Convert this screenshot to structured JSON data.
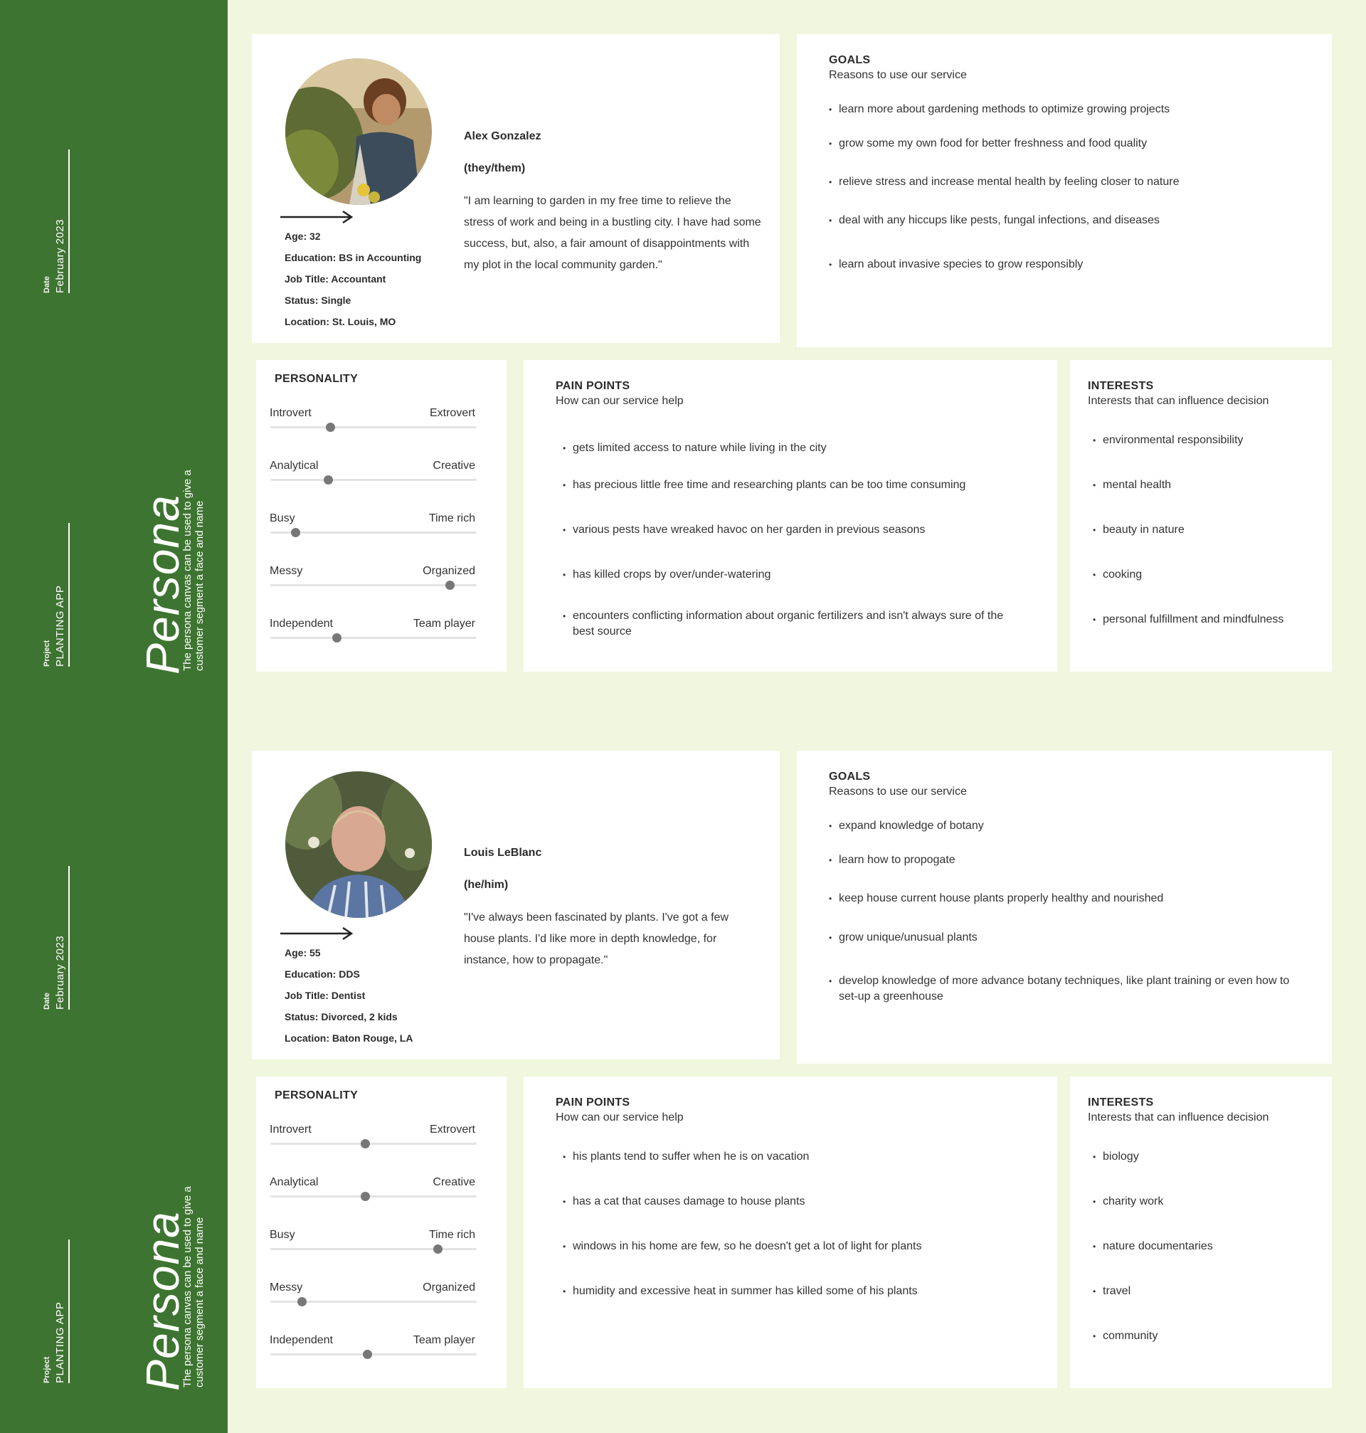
{
  "sidebar": {
    "date_label": "Date",
    "date_value": "February 2023",
    "project_label": "Project",
    "project_value": "PLANTING APP",
    "title": "Persona",
    "subtitle": "The persona canvas can be used to give a customer segment a face and name"
  },
  "personas": [
    {
      "name": "Alex Gonzalez",
      "pronouns": "(they/them)",
      "quote": "\"I am learning to garden in my free time to relieve the stress of work and being in a bustling city. I have had some success, but, also, a fair amount of disappointments with my plot in the local community garden.\"",
      "demographics": [
        "Age: 32",
        "Education: BS in Accounting",
        "Job Title: Accountant",
        "Status: Single",
        "Location: St. Louis, MO"
      ],
      "goals": {
        "title": "GOALS",
        "subtitle": "Reasons to use our service",
        "items": [
          "learn more about gardening methods to optimize growing projects",
          "grow some my own food for better freshness and food quality",
          "relieve stress and increase mental health by feeling closer to nature",
          "deal with any hiccups like pests, fungal infections, and diseases",
          "learn about invasive species to grow responsibly"
        ]
      },
      "personality": {
        "title": "PERSONALITY",
        "traits": [
          {
            "left": "Introvert",
            "right": "Extrovert",
            "value": 0.29
          },
          {
            "left": "Analytical",
            "right": "Creative",
            "value": 0.28
          },
          {
            "left": "Busy",
            "right": "Time rich",
            "value": 0.12
          },
          {
            "left": "Messy",
            "right": "Organized",
            "value": 0.87
          },
          {
            "left": "Independent",
            "right": "Team player",
            "value": 0.32
          }
        ]
      },
      "pain_points": {
        "title": "PAIN POINTS",
        "subtitle": "How can our service help",
        "items": [
          "gets limited access to nature while living in the city",
          "has precious little free time and researching plants can be too time consuming",
          "various pests have wreaked havoc on her garden in previous seasons",
          "has killed crops by over/under-watering",
          "encounters conflicting information about organic fertilizers and isn't always sure of the best source"
        ]
      },
      "interests": {
        "title": "INTERESTS",
        "subtitle": "Interests that can influence decision",
        "items": [
          "environmental responsibility",
          "mental health",
          "beauty in nature",
          "cooking",
          "personal fulfillment and mindfulness"
        ]
      }
    },
    {
      "name": "Louis LeBlanc",
      "pronouns": "(he/him)",
      "quote": "\"I've always been fascinated by plants. I've got a few house plants. I'd like more in depth knowledge, for instance, how to propagate.\"",
      "demographics": [
        "Age: 55",
        "Education: DDS",
        "Job Title: Dentist",
        "Status: Divorced, 2 kids",
        "Location: Baton Rouge, LA"
      ],
      "goals": {
        "title": "GOALS",
        "subtitle": "Reasons to use our service",
        "items": [
          "expand knowledge of botany",
          "learn how to propogate",
          "keep house current house plants properly healthy and nourished",
          "grow unique/unusual plants",
          "develop knowledge of more advance botany techniques, like plant training or even how to set-up a greenhouse"
        ]
      },
      "personality": {
        "title": "PERSONALITY",
        "traits": [
          {
            "left": "Introvert",
            "right": "Extrovert",
            "value": 0.46
          },
          {
            "left": "Analytical",
            "right": "Creative",
            "value": 0.46
          },
          {
            "left": "Busy",
            "right": "Time rich",
            "value": 0.81
          },
          {
            "left": "Messy",
            "right": "Organized",
            "value": 0.15
          },
          {
            "left": "Independent",
            "right": "Team player",
            "value": 0.47
          }
        ]
      },
      "pain_points": {
        "title": "PAIN POINTS",
        "subtitle": "How can our service help",
        "items": [
          "his plants tend to suffer when he is on vacation",
          "has a cat that causes damage to house plants",
          "windows in his home are few, so he doesn't get a lot of light for plants",
          "humidity and excessive heat in summer has killed some of his plants"
        ]
      },
      "interests": {
        "title": "INTERESTS",
        "subtitle": "Interests that can influence decision",
        "items": [
          "biology",
          "charity work",
          "nature documentaries",
          "travel",
          "community"
        ]
      }
    }
  ]
}
